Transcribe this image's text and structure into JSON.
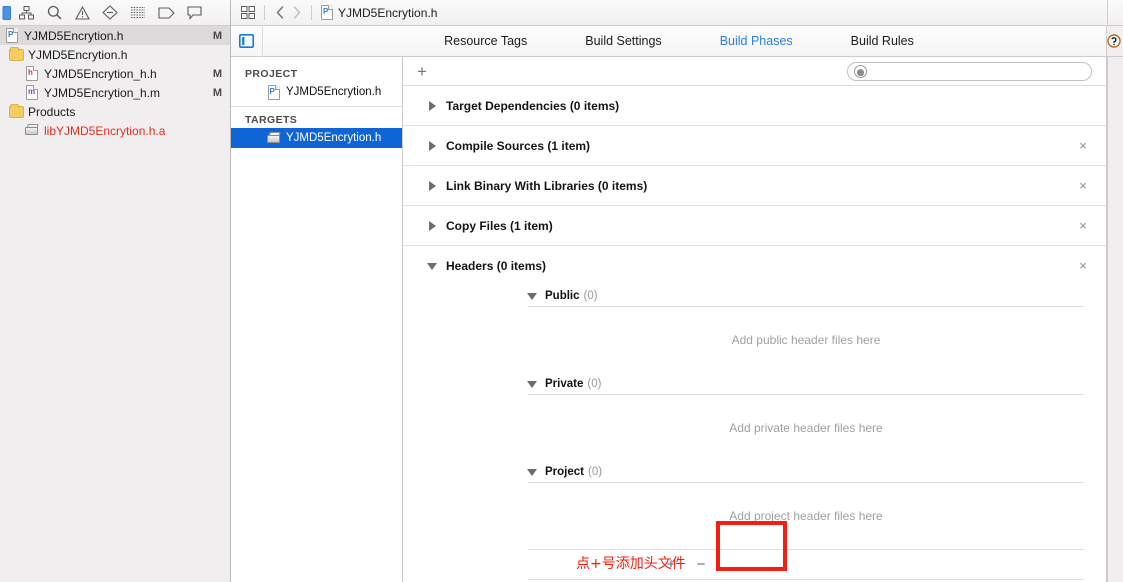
{
  "navigator": {
    "toolbar_icons": [
      {
        "name": "project-navigator-icon",
        "selected": true
      },
      {
        "name": "source-control-navigator-icon",
        "selected": false
      },
      {
        "name": "search-navigator-icon",
        "selected": false
      },
      {
        "name": "issue-navigator-icon",
        "selected": false
      },
      {
        "name": "test-navigator-icon",
        "selected": false
      },
      {
        "name": "debug-navigator-icon",
        "selected": false
      },
      {
        "name": "breakpoint-navigator-icon",
        "selected": false
      },
      {
        "name": "report-navigator-icon",
        "selected": false
      }
    ],
    "rows": [
      {
        "label": "YJMD5Encrytion.h",
        "badge": "M",
        "icon": "project-file-icon",
        "indent": 0,
        "selected": true,
        "color": "normal"
      },
      {
        "label": "YJMD5Encrytion.h",
        "badge": "",
        "icon": "folder-icon",
        "indent": 1,
        "selected": false,
        "color": "normal"
      },
      {
        "label": "YJMD5Encrytion_h.h",
        "badge": "M",
        "icon": "header-file-icon",
        "indent": 2,
        "selected": false,
        "color": "normal"
      },
      {
        "label": "YJMD5Encrytion_h.m",
        "badge": "M",
        "icon": "objc-file-icon",
        "indent": 2,
        "selected": false,
        "color": "normal"
      },
      {
        "label": "Products",
        "badge": "",
        "icon": "folder-icon",
        "indent": 1,
        "selected": false,
        "color": "normal"
      },
      {
        "label": "libYJMD5Encrytion.h.a",
        "badge": "",
        "icon": "library-icon",
        "indent": 2,
        "selected": false,
        "color": "red"
      }
    ]
  },
  "jumpbar": {
    "grid_icon": "related-items-icon",
    "back_icon": "chevron-left-icon",
    "forward_icon": "chevron-right-icon",
    "file_icon": "project-file-icon",
    "file_name": "YJMD5Encrytion.h"
  },
  "tabbar": {
    "toggle_icon": "panel-toggle-icon",
    "help_icon": "help-circle-icon",
    "tabs": [
      {
        "label": "Resource Tags",
        "active": false
      },
      {
        "label": "Build Settings",
        "active": false
      },
      {
        "label": "Build Phases",
        "active": true
      },
      {
        "label": "Build Rules",
        "active": false
      }
    ]
  },
  "target_pane": {
    "project_header": "PROJECT",
    "targets_header": "TARGETS",
    "project_items": [
      {
        "label": "YJMD5Encrytion.h",
        "icon": "project-file-icon",
        "selected": false
      }
    ],
    "target_items": [
      {
        "label": "YJMD5Encrytion.h",
        "icon": "library-icon",
        "selected": true
      }
    ]
  },
  "phases_toolbar": {
    "add_label": "+",
    "search_icon": "search-icon",
    "search_value": "",
    "search_placeholder": ""
  },
  "phases": [
    {
      "title": "Target Dependencies (0 items)",
      "expanded": false,
      "removable": false,
      "close_label": "×"
    },
    {
      "title": "Compile Sources (1 item)",
      "expanded": false,
      "removable": true,
      "close_label": "×"
    },
    {
      "title": "Link Binary With Libraries (0 items)",
      "expanded": false,
      "removable": true,
      "close_label": "×"
    },
    {
      "title": "Copy Files (1 item)",
      "expanded": false,
      "removable": true,
      "close_label": "×"
    },
    {
      "title": "Headers (0 items)",
      "expanded": true,
      "removable": true,
      "close_label": "×"
    }
  ],
  "headers_section": {
    "subsections": [
      {
        "title": "Public",
        "count": "(0)",
        "placeholder": "Add public header files here"
      },
      {
        "title": "Private",
        "count": "(0)",
        "placeholder": "Add private header files here"
      },
      {
        "title": "Project",
        "count": "(0)",
        "placeholder": "Add project header files here"
      }
    ],
    "footer": {
      "add_label": "+",
      "remove_label": "−"
    }
  },
  "annotation": {
    "text": "点+号添加头文件",
    "color": "#f41f10"
  }
}
